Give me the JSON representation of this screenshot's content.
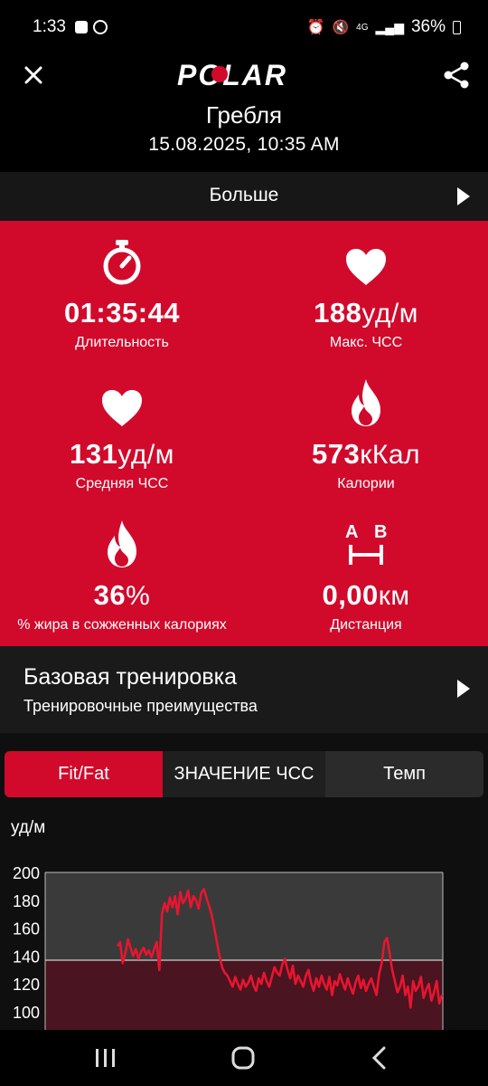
{
  "status_bar": {
    "time": "1:33",
    "battery": "36%",
    "network": "4G"
  },
  "header": {
    "brand": "POLAR",
    "title": "Гребля",
    "datetime": "15.08.2025, 10:35 AM"
  },
  "more": {
    "label": "Больше"
  },
  "stats": [
    {
      "icon": "stopwatch-icon",
      "value": "01:35:44",
      "unit": "",
      "label": "Длительность"
    },
    {
      "icon": "heart-icon",
      "value": "188",
      "unit": "уд/м",
      "label": "Макс. ЧСС"
    },
    {
      "icon": "heart-icon",
      "value": "131",
      "unit": "уд/м",
      "label": "Средняя ЧСС"
    },
    {
      "icon": "flame-icon",
      "value": "573",
      "unit": "кКал",
      "label": "Калории"
    },
    {
      "icon": "flame-icon",
      "value": "36",
      "unit": "%",
      "label": "% жира в сожженных калориях"
    },
    {
      "icon": "distance-icon",
      "value": "0,00",
      "unit": "км",
      "label": "Дистанция"
    }
  ],
  "training": {
    "title": "Базовая тренировка",
    "subtitle": "Тренировочные преимущества"
  },
  "tabs": [
    {
      "label": "Fit/Fat",
      "active": true
    },
    {
      "label": "ЗНАЧЕНИЕ ЧСС",
      "active": false
    },
    {
      "label": "Темп",
      "active": false
    }
  ],
  "chart_data": {
    "type": "line",
    "ylabel": "уд/м",
    "ylim": [
      100,
      200
    ],
    "yticks": [
      200,
      180,
      160,
      140,
      120,
      100
    ],
    "threshold": 137,
    "series": [
      {
        "values": [
          147,
          150,
          135,
          142,
          152,
          146,
          140,
          145,
          138,
          143,
          146,
          141,
          144,
          139,
          145,
          150,
          130,
          170,
          178,
          172,
          182,
          175,
          183,
          170,
          186,
          178,
          181,
          187,
          175,
          183,
          180,
          174,
          185,
          188,
          182,
          176,
          170,
          160,
          150,
          140,
          132,
          128,
          126,
          122,
          118,
          125,
          120,
          116,
          123,
          118,
          121,
          126,
          119,
          115,
          124,
          120,
          128,
          122,
          118,
          125,
          132,
          128,
          126,
          134,
          138,
          130,
          124,
          133,
          120,
          126,
          122,
          118,
          126,
          130,
          121,
          115,
          124,
          118,
          126,
          120,
          116,
          125,
          112,
          122,
          119,
          127,
          121,
          116,
          124,
          118,
          113,
          121,
          126,
          117,
          123,
          115,
          120,
          124,
          118,
          112,
          127,
          135,
          150,
          153,
          142,
          130,
          122,
          114,
          118,
          126,
          112,
          118,
          103,
          122,
          115,
          118,
          125,
          110,
          116,
          120,
          108,
          114,
          122,
          106,
          112
        ]
      }
    ]
  },
  "colors": {
    "accent": "#d10a2c",
    "background": "#0f0f0f"
  }
}
